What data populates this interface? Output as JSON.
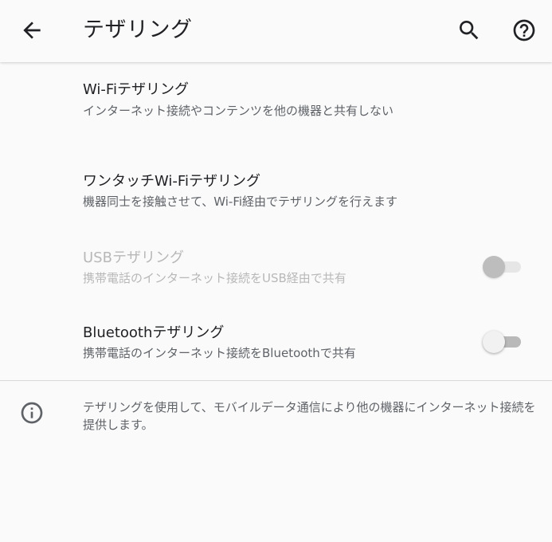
{
  "appbar": {
    "title": "テザリング",
    "icons": {
      "back": "arrow-back-icon",
      "search": "search-icon",
      "help": "help-icon"
    }
  },
  "items": [
    {
      "title": "Wi-Fiテザリング",
      "summary": "インターネット接続やコンテンツを他の機器と共有しない",
      "has_switch": false,
      "enabled": true
    },
    {
      "title": "ワンタッチWi-Fiテザリング",
      "summary": "機器同士を接触させて、Wi-Fi経由でテザリングを行えます",
      "has_switch": false,
      "enabled": true
    },
    {
      "title": "USBテザリング",
      "summary": "携帯電話のインターネット接続をUSB経由で共有",
      "has_switch": true,
      "switch_on": false,
      "enabled": false
    },
    {
      "title": "Bluetoothテザリング",
      "summary": "携帯電話のインターネット接続をBluetoothで共有",
      "has_switch": true,
      "switch_on": false,
      "enabled": true
    }
  ],
  "footer": {
    "icon": "info-icon",
    "text": "テザリングを使用して、モバイルデータ通信により他の機器にインターネット接続を提供します。"
  },
  "colors": {
    "background": "#fafafa",
    "title_text": "#202124",
    "summary_text": "#5f6368",
    "disabled_text": "#b8b8b8",
    "icon": "#202124"
  }
}
